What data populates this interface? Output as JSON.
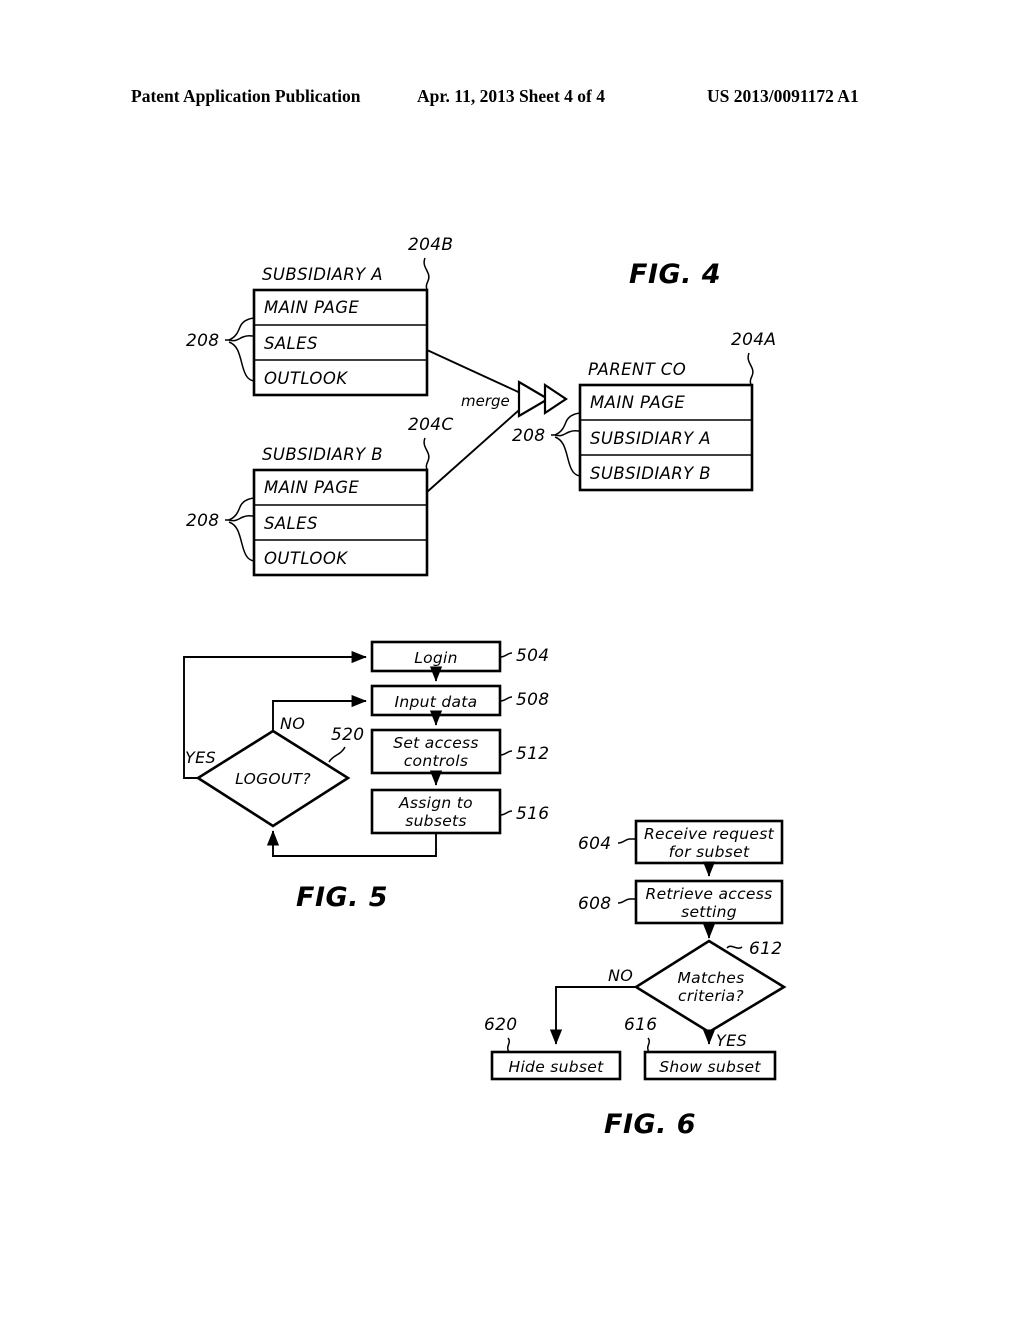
{
  "header": {
    "publication": "Patent Application Publication",
    "date_sheet": "Apr. 11, 2013  Sheet 4 of 4",
    "doc_number": "US 2013/0091172 A1"
  },
  "figures": {
    "fig4": {
      "caption": "FIG.  4",
      "merge_label": "merge",
      "blocks": [
        {
          "id": "subsidiary-a",
          "title": "SUBSIDIARY A",
          "ref_box": "204B",
          "ref_rows": "208",
          "rows": [
            "MAIN PAGE",
            "SALES",
            "OUTLOOK"
          ]
        },
        {
          "id": "subsidiary-b",
          "title": "SUBSIDIARY B",
          "ref_box": "204C",
          "ref_rows": "208",
          "rows": [
            "MAIN PAGE",
            "SALES",
            "OUTLOOK"
          ]
        },
        {
          "id": "parent-co",
          "title": "PARENT CO",
          "ref_box": "204A",
          "ref_rows": "208",
          "rows": [
            "MAIN PAGE",
            "SUBSIDIARY A",
            "SUBSIDIARY B"
          ]
        }
      ]
    },
    "fig5": {
      "caption": "FIG.  5",
      "steps": [
        {
          "id": "login",
          "label": "Login",
          "ref": "504"
        },
        {
          "id": "input",
          "label": "Input data",
          "ref": "508"
        },
        {
          "id": "set",
          "label_1": "Set  access",
          "label_2": "controls",
          "ref": "512"
        },
        {
          "id": "assign",
          "label_1": "Assign  to",
          "label_2": "subsets",
          "ref": "516"
        }
      ],
      "decision": {
        "id": "logout",
        "label": "LOGOUT?",
        "ref": "520",
        "branch_yes": "YES",
        "branch_no": "NO"
      }
    },
    "fig6": {
      "caption": "FIG.  6",
      "steps": [
        {
          "id": "receive",
          "label_1": "Receive request",
          "label_2": "for  subset",
          "ref": "604"
        },
        {
          "id": "retrieve",
          "label_1": "Retrieve  access",
          "label_2": "setting",
          "ref": "608"
        }
      ],
      "decision": {
        "id": "matches",
        "label_1": "Matches",
        "label_2": "criteria?",
        "ref": "612",
        "branch_yes": "YES",
        "branch_no": "NO"
      },
      "outcomes": [
        {
          "id": "hide",
          "label": "Hide subset",
          "ref": "620"
        },
        {
          "id": "show",
          "label": "Show subset",
          "ref": "616"
        }
      ]
    }
  },
  "colors": {
    "ink": "#000000",
    "paper": "#ffffff"
  }
}
